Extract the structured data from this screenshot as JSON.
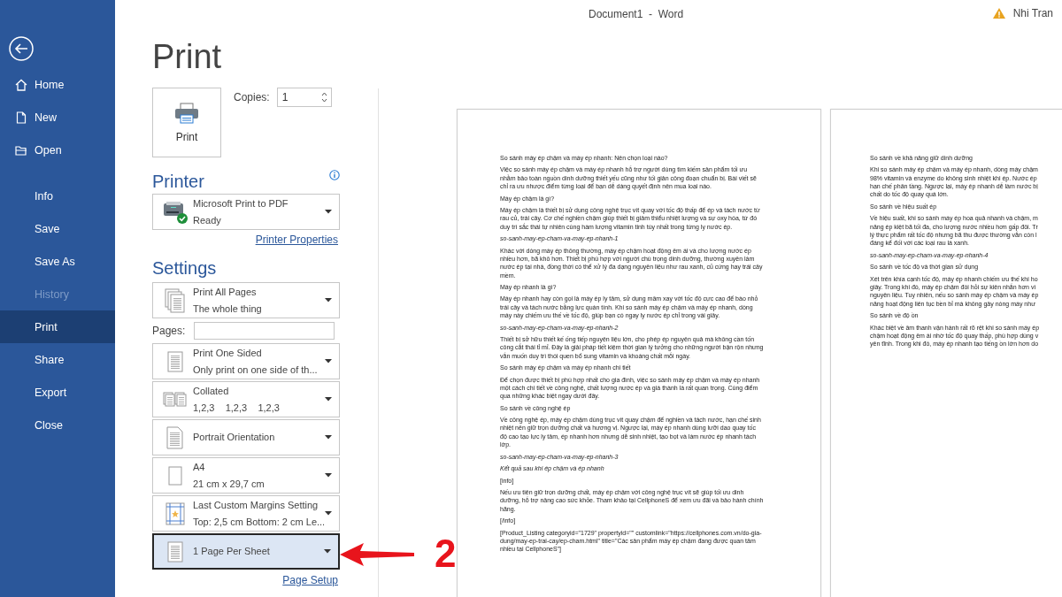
{
  "window": {
    "title": "Document1  -  Word",
    "user": "Nhi Tran"
  },
  "nav": {
    "primary": [
      {
        "label": "Home",
        "selected": false,
        "disabled": false
      },
      {
        "label": "New",
        "selected": false,
        "disabled": false
      },
      {
        "label": "Open",
        "selected": false,
        "disabled": false
      }
    ],
    "secondary": [
      {
        "label": "Info",
        "selected": false,
        "disabled": false
      },
      {
        "label": "Save",
        "selected": false,
        "disabled": false
      },
      {
        "label": "Save As",
        "selected": false,
        "disabled": false
      },
      {
        "label": "History",
        "selected": false,
        "disabled": true
      },
      {
        "label": "Print",
        "selected": true,
        "disabled": false
      },
      {
        "label": "Share",
        "selected": false,
        "disabled": false
      },
      {
        "label": "Export",
        "selected": false,
        "disabled": false
      },
      {
        "label": "Close",
        "selected": false,
        "disabled": false
      }
    ]
  },
  "print": {
    "heading": "Print",
    "button": "Print",
    "copies": {
      "label": "Copies:",
      "value": "1"
    }
  },
  "printer": {
    "heading": "Printer",
    "name": "Microsoft Print to PDF",
    "status": "Ready",
    "link": "Printer Properties"
  },
  "settings": {
    "heading": "Settings",
    "link": "Page Setup",
    "options": [
      {
        "kind": "dropdown",
        "title": "Print All Pages",
        "subtitle": "The whole thing",
        "selected": false
      },
      {
        "kind": "pages",
        "label": "Pages:"
      },
      {
        "kind": "dropdown",
        "title": "Print One Sided",
        "subtitle": "Only print on one side of th...",
        "selected": false
      },
      {
        "kind": "dropdown",
        "title": "Collated",
        "subtitle": "1,2,3    1,2,3    1,2,3",
        "selected": false
      },
      {
        "kind": "dropdown",
        "title": "Portrait Orientation",
        "selected": false
      },
      {
        "kind": "dropdown",
        "title": "A4",
        "subtitle": "21 cm x 29,7 cm",
        "selected": false
      },
      {
        "kind": "dropdown",
        "title": "Last Custom Margins Setting",
        "subtitle": "Top: 2,5 cm Bottom: 2 cm Le...",
        "selected": false
      },
      {
        "kind": "dropdown",
        "title": "1 Page Per Sheet",
        "selected": true
      }
    ]
  },
  "preview": {
    "pages": [
      {
        "paragraphs": [
          {
            "kind": "normal",
            "lines": [
              "So sánh máy ép chậm và máy ép nhanh: Nên chọn loại nào?"
            ]
          },
          {
            "kind": "normal",
            "lines": [
              "Việc so sánh máy ép chậm và máy ép nhanh hỗ trợ người dùng tìm kiếm sản phẩm tối ưu",
              "nhằm bảo toàn nguồn dinh dưỡng thiết yếu cũng như tối giản công đoạn chuẩn bị. Bài viết sẽ",
              "chỉ ra ưu nhược điểm từng loại để bạn dễ dàng quyết định nên mua loại nào."
            ]
          },
          {
            "kind": "normal",
            "lines": [
              "Máy ép chậm là gì?"
            ]
          },
          {
            "kind": "normal",
            "lines": [
              "Máy ép chậm là thiết bị sử dụng công nghệ trục vít quay với tốc độ thấp để ép và tách nước từ",
              "rau củ, trái cây. Cơ chế nghiền chậm giúp thiết bị giảm thiểu nhiệt lượng và sự oxy hóa, từ đó",
              "duy trì sắc thái tự nhiên cùng hàm lượng vitamin tinh túy nhất trong từng ly nước ép."
            ]
          },
          {
            "kind": "italic",
            "lines": [
              "so-sanh-may-ep-cham-va-may-ep-nhanh-1"
            ]
          },
          {
            "kind": "normal",
            "lines": [
              "Khác với dòng máy ép thông thường, máy ép chậm hoạt động êm ái và cho lượng nước ép",
              "nhiều hơn, bã khô hơn. Thiết bị phù hợp với người chú trọng dinh dưỡng, thường xuyên làm",
              "nước ép tại nhà, đồng thời có thể xử lý đa dạng nguyên liệu như rau xanh, củ cứng hay trái cây",
              "mềm."
            ]
          },
          {
            "kind": "normal",
            "lines": [
              "Máy ép nhanh là gì?"
            ]
          },
          {
            "kind": "normal",
            "lines": [
              "Máy ép nhanh hay còn gọi là máy ép ly tâm, sử dụng mâm xay với tốc độ cực cao để bào nhỏ",
              "trái cây và tách nước bằng lực quán tính. Khi so sánh máy ép chậm và máy ép nhanh, dòng",
              "máy này chiếm ưu thế về tốc độ, giúp bạn có ngay ly nước ép chỉ trong vài giây."
            ]
          },
          {
            "kind": "italic",
            "lines": [
              "so-sanh-may-ep-cham-va-may-ep-nhanh-2"
            ]
          },
          {
            "kind": "normal",
            "lines": [
              "Thiết bị sở hữu thiết kế ống tiếp nguyên liệu lớn, cho phép ép nguyên quả mà không cần tốn",
              "công cắt thái tỉ mỉ. Đây là giải pháp tiết kiệm thời gian lý tưởng cho những người bận rộn nhưng",
              "vẫn muốn duy trì thói quen bổ sung vitamin và khoáng chất mỗi ngày."
            ]
          },
          {
            "kind": "normal",
            "lines": [
              "So sánh máy ép chậm và máy ép nhanh chi tiết"
            ]
          },
          {
            "kind": "normal",
            "lines": [
              "Để chọn được thiết bị phù hợp nhất cho gia đình, việc so sánh máy ép chậm và máy ép nhanh",
              "một cách chi tiết về công nghệ, chất lượng nước ép và giá thành là rất quan trọng. Cùng điểm",
              "qua những khác biệt ngay dưới đây."
            ]
          },
          {
            "kind": "normal",
            "lines": [
              "So sánh về công nghệ ép"
            ]
          },
          {
            "kind": "normal",
            "lines": [
              "Về công nghệ ép, máy ép chậm dùng trục vít quay chậm để nghiền và tách nước, hạn chế sinh",
              "nhiệt nên giữ trọn dưỡng chất và hương vị. Ngược lại, máy ép nhanh dùng lưỡi dao quay tốc",
              "độ cao tạo lực ly tâm, ép nhanh hơn nhưng dễ sinh nhiệt, tạo bọt và làm nước ép nhanh tách",
              "lớp."
            ]
          },
          {
            "kind": "italic",
            "lines": [
              "so-sanh-may-ep-cham-va-may-ep-nhanh-3"
            ]
          },
          {
            "kind": "italic",
            "lines": [
              "Kết quả sau khi ép chậm và ép nhanh"
            ]
          },
          {
            "kind": "normal",
            "lines": [
              "[info]"
            ]
          },
          {
            "kind": "normal",
            "lines": [
              "Nếu ưu tiên giữ trọn dưỡng chất, máy ép chậm với công nghệ trục vít sẽ giúp tối ưu dinh",
              "dưỡng, hỗ trợ nâng cao sức khỏe. Tham khảo tại CellphoneS để xem ưu đãi và bảo hành chính",
              "hãng."
            ]
          },
          {
            "kind": "normal",
            "lines": [
              "[/info]"
            ]
          },
          {
            "kind": "normal",
            "lines": [
              "[Product_Listing categoryid=\"1729\" propertyid=\"\" customlink=\"https://cellphones.com.vn/do-gia-",
              "dung/may-ep-trai-cay/ep-cham.html\" title=\"Các sản phẩm máy ép chậm đang được quan tâm",
              "nhiều tại CellphoneS\"]"
            ]
          }
        ]
      },
      {
        "paragraphs": [
          {
            "kind": "normal",
            "lines": [
              "So sánh về khả năng giữ dinh dưỡng"
            ]
          },
          {
            "kind": "normal",
            "lines": [
              "Khi so sánh máy ép chậm và máy ép nhanh, dòng máy chậm",
              "98% vitamin và enzyme do không sinh nhiệt khi ép. Nước ép",
              "hạn chế phân tầng. Ngược lại, máy ép nhanh dễ làm nước bị",
              "chất do tốc độ quay quá lớn."
            ]
          },
          {
            "kind": "normal",
            "lines": [
              "So sánh về hiệu suất ép"
            ]
          },
          {
            "kind": "normal",
            "lines": [
              "Về hiệu suất, khi so sánh máy ép hoa quả nhanh và chậm, m",
              "năng ép kiệt bã tối đa, cho lượng nước nhiều hơn gấp đôi. Tr",
              "lý thực phẩm rất tốc độ nhưng bã thu được thường vẫn còn l",
              "đáng kể đối với các loại rau lá xanh."
            ]
          },
          {
            "kind": "italic",
            "lines": [
              "so-sanh-may-ep-cham-va-may-ep-nhanh-4"
            ]
          },
          {
            "kind": "normal",
            "lines": [
              "So sánh về tốc độ và thời gian sử dụng"
            ]
          },
          {
            "kind": "normal",
            "lines": [
              "Xét trên khía cạnh tốc độ, máy ép nhanh chiếm ưu thế khi ho",
              "giây. Trong khi đó, máy ép chậm đòi hỏi sự kiên nhẫn hơn vì",
              "nguyên liệu. Tuy nhiên, nếu so sánh máy ép chậm và máy ép",
              "năng hoạt động liên tục bền bỉ mà không gây nóng máy như"
            ]
          },
          {
            "kind": "normal",
            "lines": [
              "So sánh về độ ồn"
            ]
          },
          {
            "kind": "normal",
            "lines": [
              "Khác biệt về âm thanh vận hành rất rõ rệt khi so sánh máy ép",
              "chậm hoạt động êm ái nhờ tốc độ quay thấp, phù hợp dùng v",
              "yên tĩnh. Trong khi đó, máy ép nhanh tạo tiếng ồn lớn hơn do"
            ]
          }
        ]
      }
    ]
  },
  "annotation": {
    "label": "2"
  }
}
